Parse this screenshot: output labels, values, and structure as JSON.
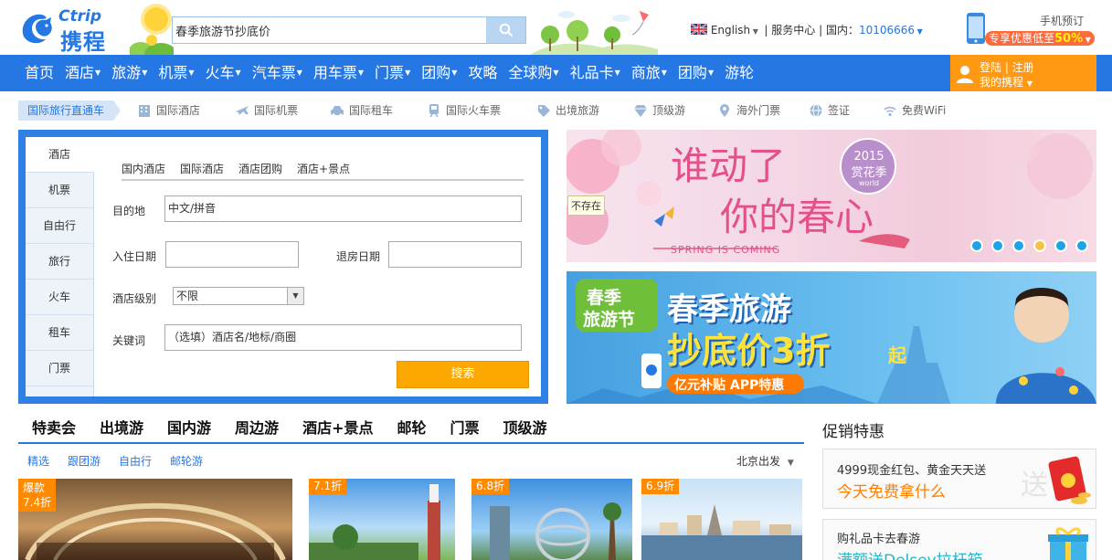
{
  "header": {
    "logo_en": "Ctrip",
    "logo_cn": "携程",
    "search_value": "春季旅游节抄底价",
    "language": "English",
    "service": "| 服务中心 | 国内：",
    "hotline": "10106666",
    "phone_title": "手机预订",
    "phone_promo": "专享优惠低至",
    "phone_discount": "50%"
  },
  "nav": {
    "items": [
      {
        "label": "首页",
        "arrow": false
      },
      {
        "label": "酒店",
        "arrow": true
      },
      {
        "label": "旅游",
        "arrow": true
      },
      {
        "label": "机票",
        "arrow": true
      },
      {
        "label": "火车",
        "arrow": true
      },
      {
        "label": "汽车票",
        "arrow": true
      },
      {
        "label": "用车票",
        "arrow": true
      },
      {
        "label": "门票",
        "arrow": true
      },
      {
        "label": "团购",
        "arrow": true
      },
      {
        "label": "攻略",
        "arrow": false
      },
      {
        "label": "全球购",
        "arrow": true
      },
      {
        "label": "礼品卡",
        "arrow": true
      },
      {
        "label": "商旅",
        "arrow": true
      },
      {
        "label": "团购",
        "arrow": true
      },
      {
        "label": "游轮",
        "arrow": false
      }
    ],
    "login": "登陆 | 注册",
    "my_trips": "我的携程"
  },
  "subnav": {
    "direct": "国际旅行直通车",
    "items": [
      {
        "label": "国际酒店",
        "icon": "building-icon"
      },
      {
        "label": "国际机票",
        "icon": "plane-icon"
      },
      {
        "label": "国际租车",
        "icon": "car-icon"
      },
      {
        "label": "国际火车票",
        "icon": "train-icon"
      },
      {
        "label": "出境旅游",
        "icon": "tag-icon"
      },
      {
        "label": "顶级游",
        "icon": "diamond-icon"
      },
      {
        "label": "海外门票",
        "icon": "pin-icon"
      },
      {
        "label": "签证",
        "icon": "globe-icon"
      },
      {
        "label": "免费WiFi",
        "icon": "wifi-icon"
      }
    ]
  },
  "panel": {
    "vtabs": [
      "酒店",
      "机票",
      "自由行",
      "旅行",
      "火车",
      "租车",
      "门票"
    ],
    "htabs": [
      "国内酒店",
      "国际酒店",
      "酒店团购",
      "酒店+景点"
    ],
    "dest_label": "目的地",
    "dest_placeholder": "中文/拼音",
    "checkin_label": "入住日期",
    "checkout_label": "退房日期",
    "level_label": "酒店级别",
    "level_value": "不限",
    "keyword_label": "关键词",
    "keyword_placeholder": "（选填）酒店名/地标/商圈",
    "submit": "搜索"
  },
  "banner1": {
    "title1": "谁动了",
    "title2": "你的春心",
    "year": "2015",
    "badge": "赏花季",
    "badge_sub": "world",
    "slogan": "SPRING IS COMING",
    "absent": "不存在",
    "active_dot": 3,
    "dot_count": 6
  },
  "banner2": {
    "badge1": "春季",
    "badge2": "旅游节",
    "line1": "春季旅游",
    "line2": "抄底价3折",
    "line2_suffix": "起",
    "app": "亿元补贴 APP特惠"
  },
  "tabs": {
    "items": [
      "特卖会",
      "出境游",
      "国内游",
      "周边游",
      "酒店+景点",
      "邮轮",
      "门票",
      "顶级游"
    ],
    "sub": [
      "精选",
      "跟团游",
      "自由行",
      "邮轮游"
    ],
    "departure": "北京出发"
  },
  "thumbs": [
    {
      "tag1": "爆款",
      "tag2": "7.4折"
    },
    {
      "tag1": "7.1折"
    },
    {
      "tag1": "6.8折"
    },
    {
      "tag1": "6.9折"
    }
  ],
  "promo": {
    "title": "促销特惠",
    "card1_t1": "4999现金红包、黄金天天送",
    "card1_t2": "今天免费拿什么",
    "card1_mark": "送",
    "card2_t1": "购礼品卡去春游",
    "card2_t2": "满额送Delsey拉杆箱"
  },
  "colors": {
    "brand": "#2577e3",
    "accent": "#ff9913",
    "button": "#fca800"
  }
}
